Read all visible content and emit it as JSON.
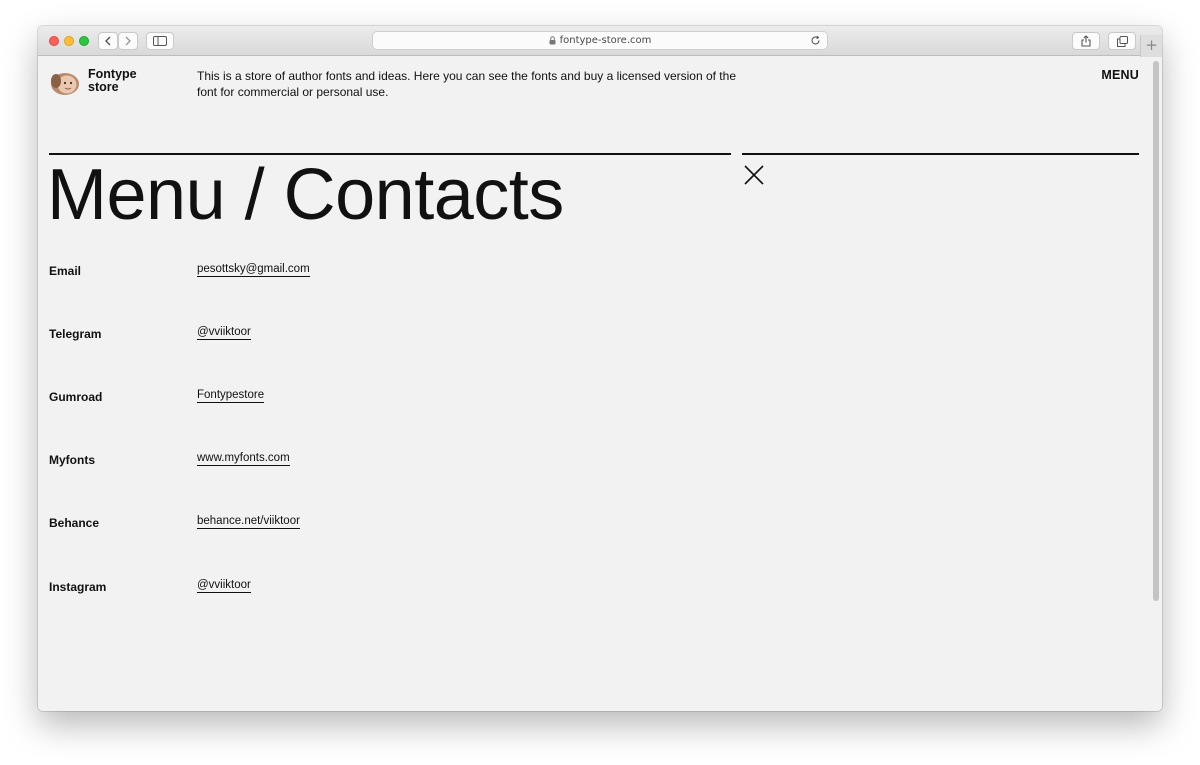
{
  "browser": {
    "url": "fontype-store.com",
    "new_tab": "+"
  },
  "header": {
    "brand": "Fontype store",
    "tagline": "This is a store of author fonts and ideas. Here you can see the fonts and buy a licensed version of the font for commercial or personal use.",
    "menu_label": "MENU"
  },
  "main": {
    "title": "Menu / Contacts",
    "contacts": [
      {
        "label": "Email",
        "value": "pesottsky@gmail.com"
      },
      {
        "label": "Telegram",
        "value": "@vviiktoor"
      },
      {
        "label": "Gumroad",
        "value": "Fontypestore"
      },
      {
        "label": "Myfonts",
        "value": "www.myfonts.com"
      },
      {
        "label": "Behance",
        "value": "behance.net/viiktoor"
      },
      {
        "label": "Instagram",
        "value": "@vviiktoor"
      }
    ]
  },
  "icons": {
    "back": "chevron-left-icon",
    "forward": "chevron-right-icon",
    "sidebar": "sidebar-icon",
    "lock": "lock-icon",
    "reload": "reload-icon",
    "share": "share-icon",
    "tabs": "tabs-icon",
    "close": "close-icon"
  },
  "colors": {
    "page_background": "#f2f2f2",
    "text": "#111111",
    "traffic_red": "#fe5f57",
    "traffic_yellow": "#febc2e",
    "traffic_green": "#28c840"
  }
}
